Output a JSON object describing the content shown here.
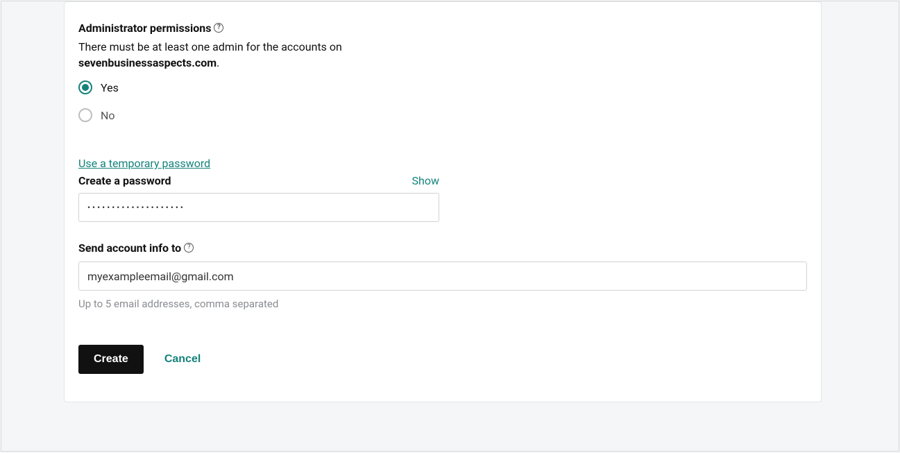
{
  "adminPermissions": {
    "title": "Administrator permissions",
    "descPrefix": "There must be at least one admin for the accounts on ",
    "domain": "sevenbusinessaspects.com",
    "descSuffix": ".",
    "options": {
      "yes": "Yes",
      "no": "No"
    },
    "selected": "yes"
  },
  "password": {
    "tempLink": "Use a temporary password",
    "label": "Create a password",
    "showLabel": "Show",
    "value": "••••••••••••••••••••"
  },
  "sendInfo": {
    "label": "Send account info to",
    "value": "myexampleemail@gmail.com",
    "helper": "Up to 5 email addresses, comma separated"
  },
  "buttons": {
    "create": "Create",
    "cancel": "Cancel"
  },
  "icons": {
    "help": "?"
  }
}
